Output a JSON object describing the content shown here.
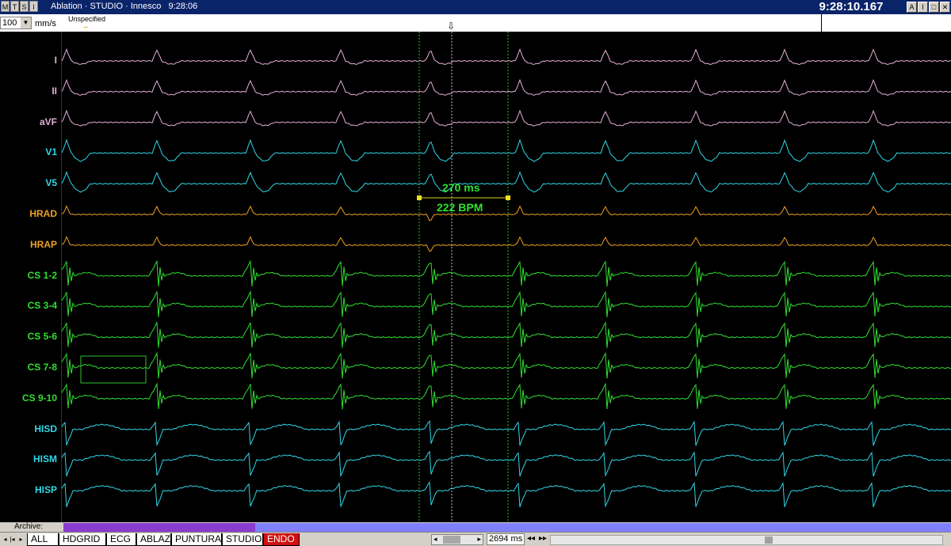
{
  "window": {
    "control_buttons": [
      "M",
      "T",
      "S",
      "I"
    ],
    "title": "Ablation · STUDIO · Innesco   9:28:06",
    "clock": "9:28:10.167",
    "win_buttons": [
      "A",
      "I",
      "□",
      "▾",
      "✕"
    ]
  },
  "toolbar": {
    "speed_value": "100",
    "speed_unit": "mm/s",
    "annotation_label": "Unspecified",
    "cursor_marker": "⇩"
  },
  "channels": [
    {
      "label": "I",
      "color": "#e6b0d6"
    },
    {
      "label": "II",
      "color": "#e6b0d6"
    },
    {
      "label": "aVF",
      "color": "#e6b0d6"
    },
    {
      "label": "V1",
      "color": "#30d8e8"
    },
    {
      "label": "V5",
      "color": "#30d8e8"
    },
    {
      "label": "HRAD",
      "color": "#f0a020"
    },
    {
      "label": "HRAP",
      "color": "#f0a020"
    },
    {
      "label": "CS 1-2",
      "color": "#30e030"
    },
    {
      "label": "CS 3-4",
      "color": "#30e030"
    },
    {
      "label": "CS 5-6",
      "color": "#30e030"
    },
    {
      "label": "CS 7-8",
      "color": "#30e030"
    },
    {
      "label": "CS 9-10",
      "color": "#30e030"
    },
    {
      "label": "HISD",
      "color": "#30d8e8"
    },
    {
      "label": "HISM",
      "color": "#30d8e8"
    },
    {
      "label": "HISP",
      "color": "#30d8e8"
    }
  ],
  "measurement": {
    "interval": "270 ms",
    "rate": "222 BPM"
  },
  "archive": {
    "label": "Archive:"
  },
  "tabs": [
    {
      "label": "ALL",
      "active": false
    },
    {
      "label": "HDGRID",
      "active": false
    },
    {
      "label": "ECG",
      "active": false
    },
    {
      "label": "ABLAZ",
      "active": false
    },
    {
      "label": "PUNTURA",
      "active": false
    },
    {
      "label": "STUDIO",
      "active": false
    },
    {
      "label": "ENDO",
      "active": true
    }
  ],
  "footer": {
    "duration": "2694 ms",
    "controls": [
      "◂◂",
      "▸▸",
      "◂",
      "▸"
    ]
  }
}
